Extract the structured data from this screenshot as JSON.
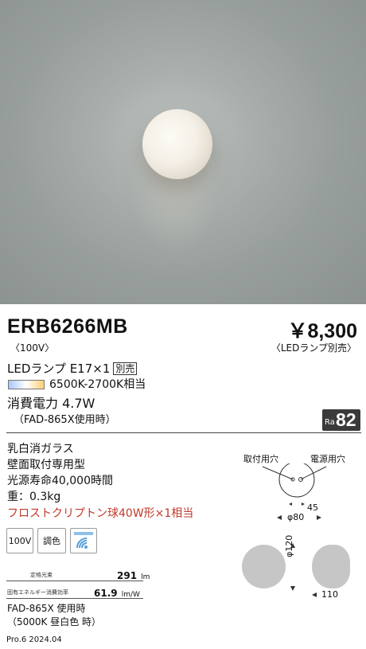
{
  "product": {
    "model": "ERB6266MB",
    "voltage_note": "〈100V〉",
    "price": "￥8,300",
    "price_note": "〈LEDランプ別売〉"
  },
  "lamp": {
    "type": "LEDランプ E17×1",
    "sold_separately": "別売",
    "color_temp": "6500K-2700K相当",
    "power": "消費電力 4.7W",
    "power_note": "（FAD-865X使用時）"
  },
  "ra": {
    "label": "Ra",
    "value": "82"
  },
  "specs": {
    "material": "乳白消ガラス",
    "mounting": "壁面取付専用型",
    "lifetime": "光源寿命40,000時間",
    "weight": "重：0.3kg",
    "equivalent": "フロストクリプトン球40W形×1相当"
  },
  "icons": {
    "voltage": "100V",
    "dimming": "調色",
    "colors": {
      "wifi": "#5aa0d8",
      "equivalent_text": "#c0392b"
    }
  },
  "rating_table": {
    "rated_flux_label": "定格光束",
    "rated_flux_value": "291",
    "rated_flux_unit": "lm",
    "efficiency_label": "固有エネルギー消費効率",
    "efficiency_value": "61.9",
    "efficiency_unit": "lm/W"
  },
  "measurement_note": {
    "line1": "FAD-865X 使用時",
    "line2": "（5000K 昼白色 時）"
  },
  "diagram": {
    "mount_hole": "取付用穴",
    "power_hole": "電源用穴",
    "dim_45": "45",
    "dim_80": "φ80",
    "dim_120": "φ120",
    "dim_110": "110"
  },
  "footer": {
    "revision": "Pro.6 2024.04"
  }
}
